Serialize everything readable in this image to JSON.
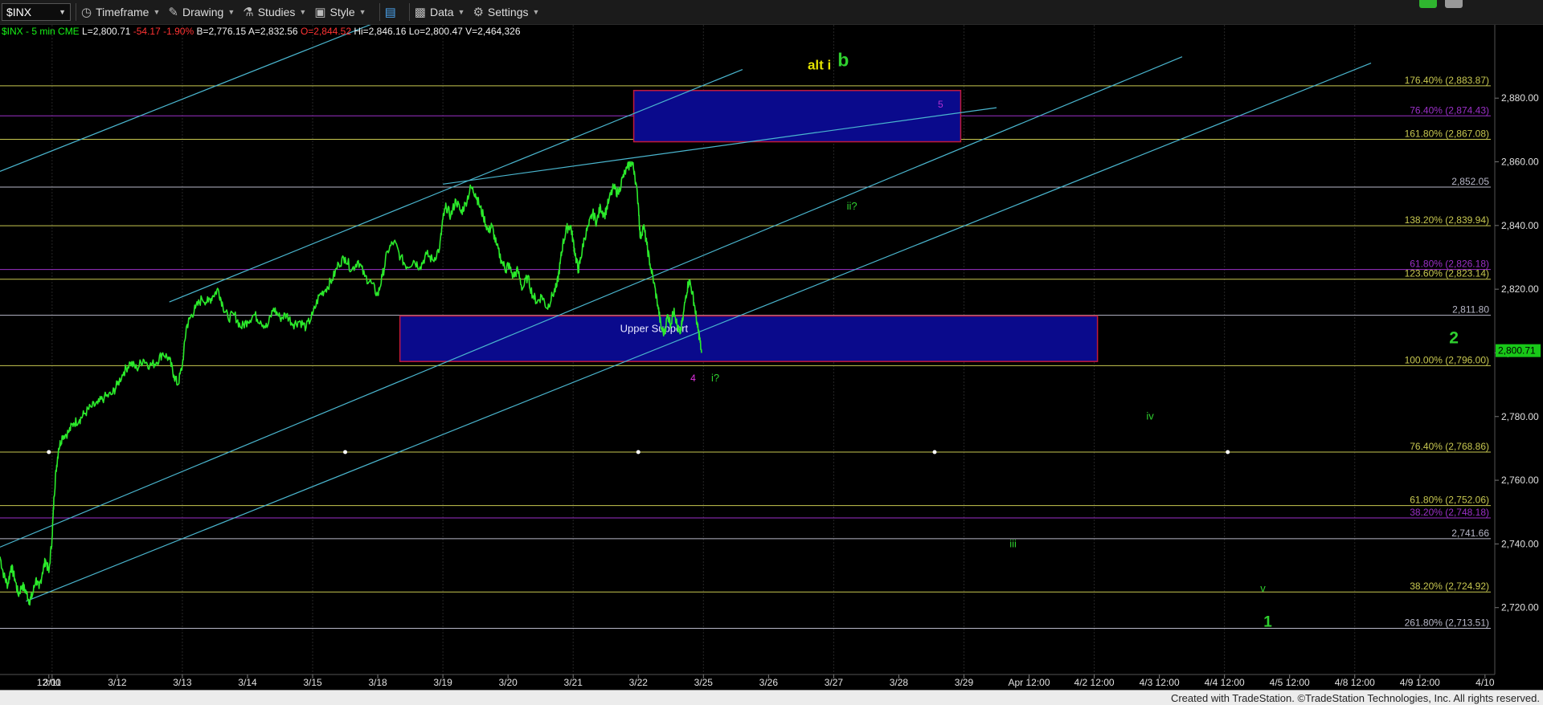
{
  "toolbar": {
    "symbol": "$INX",
    "timeframe": "Timeframe",
    "drawing": "Drawing",
    "studies": "Studies",
    "style": "Style",
    "data": "Data",
    "settings": "Settings"
  },
  "footer": "Created with TradeStation. ©TradeStation Technologies, Inc. All rights reserved.",
  "chart_data": {
    "type": "line",
    "info": [
      {
        "text": "$INX - 5 min",
        "color": "#17f317"
      },
      {
        "text": "CME",
        "color": "#17f317"
      },
      {
        "text": "L=2,800.71",
        "color": "#f0f0f0"
      },
      {
        "text": "-54.17",
        "color": "#ff3333"
      },
      {
        "text": "-1.90%",
        "color": "#ff3333"
      },
      {
        "text": "B=2,776.15",
        "color": "#f0f0f0"
      },
      {
        "text": "A=2,832.56",
        "color": "#f0f0f0"
      },
      {
        "text": "O=2,844.52",
        "color": "#ff3333"
      },
      {
        "text": "Hi=2,846.16",
        "color": "#f0f0f0"
      },
      {
        "text": "Lo=2,800.47",
        "color": "#f0f0f0"
      },
      {
        "text": "V=2,464,326",
        "color": "#f0f0f0"
      }
    ],
    "ylim": [
      2699,
      2903
    ],
    "y_ticks": [
      "2,880.00",
      "2,860.00",
      "2,840.00",
      "2,820.00",
      "2,800.00",
      "2,780.00",
      "2,760.00",
      "2,740.00",
      "2,720.00"
    ],
    "y_tick_values": [
      2880,
      2860,
      2840,
      2820,
      2800,
      2780,
      2760,
      2740,
      2720
    ],
    "x_domain": [
      -0.8,
      22.15
    ],
    "x_ticks": [
      {
        "t": -0.05,
        "label": "12:00"
      },
      {
        "t": 0,
        "label": "3/11"
      },
      {
        "t": 1,
        "label": "3/12"
      },
      {
        "t": 2,
        "label": "3/13"
      },
      {
        "t": 3,
        "label": "3/14"
      },
      {
        "t": 4,
        "label": "3/15"
      },
      {
        "t": 5,
        "label": "3/18"
      },
      {
        "t": 6,
        "label": "3/19"
      },
      {
        "t": 7,
        "label": "3/20"
      },
      {
        "t": 8,
        "label": "3/21"
      },
      {
        "t": 9,
        "label": "3/22"
      },
      {
        "t": 10,
        "label": "3/25"
      },
      {
        "t": 11,
        "label": "3/26"
      },
      {
        "t": 12,
        "label": "3/27"
      },
      {
        "t": 13,
        "label": "3/28"
      },
      {
        "t": 14,
        "label": "3/29"
      },
      {
        "t": 15,
        "label": "Apr 12:00"
      },
      {
        "t": 16,
        "label": "4/2 12:00"
      },
      {
        "t": 17,
        "label": "4/3 12:00"
      },
      {
        "t": 18,
        "label": "4/4 12:00"
      },
      {
        "t": 19,
        "label": "4/5 12:00"
      },
      {
        "t": 20,
        "label": "4/8 12:00"
      },
      {
        "t": 21,
        "label": "4/9 12:00"
      },
      {
        "t": 22,
        "label": "4/10"
      }
    ],
    "fib_levels": [
      {
        "value": 2883.87,
        "label": "176.40% (2,883.87)",
        "color": "#c8c850"
      },
      {
        "value": 2874.43,
        "label": "76.40% (2,874.43)",
        "color": "#9b30c8"
      },
      {
        "value": 2867.08,
        "label": "161.80% (2,867.08)",
        "color": "#c8c850"
      },
      {
        "value": 2852.05,
        "label": "2,852.05",
        "color": "#b8b8c8"
      },
      {
        "value": 2839.94,
        "label": "138.20% (2,839.94)",
        "color": "#c8c850"
      },
      {
        "value": 2826.18,
        "label": "61.80% (2,826.18)",
        "color": "#9b30c8"
      },
      {
        "value": 2823.14,
        "label": "123.60% (2,823.14)",
        "color": "#c8c850"
      },
      {
        "value": 2811.8,
        "label": "2,811.80",
        "color": "#b8b8c8"
      },
      {
        "value": 2796.0,
        "label": "100.00% (2,796.00)",
        "color": "#c8c850"
      },
      {
        "value": 2768.86,
        "label": "76.40% (2,768.86)",
        "color": "#c8c850"
      },
      {
        "value": 2752.06,
        "label": "61.80% (2,752.06)",
        "color": "#c8c850"
      },
      {
        "value": 2748.18,
        "label": "38.20% (2,748.18)",
        "color": "#9b30c8"
      },
      {
        "value": 2741.66,
        "label": "2,741.66",
        "color": "#b8b8c8"
      },
      {
        "value": 2724.92,
        "label": "38.20% (2,724.92)",
        "color": "#c8c850"
      },
      {
        "value": 2713.51,
        "label": "261.80% (2,713.51)",
        "color": "#b8b8c8"
      }
    ],
    "last_price": {
      "value": 2800.71,
      "label": "2,800.71"
    },
    "boxes": [
      {
        "t1": 8.93,
        "t2": 13.95,
        "y1": 2866.3,
        "y2": 2882.4,
        "label": ""
      },
      {
        "t1": 5.34,
        "t2": 16.05,
        "y1": 2797.3,
        "y2": 2811.6,
        "label": "Upper Support"
      }
    ],
    "trendlines": [
      {
        "t1": -0.8,
        "y1": 2857,
        "t2": 5.0,
        "y2": 2904
      },
      {
        "t1": 1.8,
        "y1": 2816,
        "t2": 10.6,
        "y2": 2889
      },
      {
        "t1": 6.0,
        "y1": 2853,
        "t2": 14.5,
        "y2": 2877
      },
      {
        "t1": -0.8,
        "y1": 2739,
        "t2": 17.35,
        "y2": 2893
      },
      {
        "t1": -0.4,
        "y1": 2722,
        "t2": 20.25,
        "y2": 2891
      }
    ],
    "vlines": [
      0,
      2,
      4,
      6,
      8,
      10,
      12,
      14,
      16,
      18,
      20
    ],
    "dots": [
      {
        "t": -0.05,
        "y": 2768.86
      },
      {
        "t": 4.5,
        "y": 2768.86
      },
      {
        "t": 9.0,
        "y": 2768.86
      },
      {
        "t": 13.55,
        "y": 2768.86
      },
      {
        "t": 18.05,
        "y": 2768.86
      }
    ],
    "price_path": [
      [
        -0.8,
        2736
      ],
      [
        -0.74,
        2730
      ],
      [
        -0.68,
        2727
      ],
      [
        -0.63,
        2733
      ],
      [
        -0.57,
        2729
      ],
      [
        -0.52,
        2724
      ],
      [
        -0.46,
        2727
      ],
      [
        -0.4,
        2725
      ],
      [
        -0.35,
        2722
      ],
      [
        -0.3,
        2724
      ],
      [
        -0.25,
        2729
      ],
      [
        -0.2,
        2726
      ],
      [
        -0.15,
        2731
      ],
      [
        -0.1,
        2735
      ],
      [
        -0.05,
        2731
      ],
      [
        0.0,
        2742
      ],
      [
        0.03,
        2755
      ],
      [
        0.06,
        2763
      ],
      [
        0.1,
        2770
      ],
      [
        0.16,
        2774
      ],
      [
        0.25,
        2775
      ],
      [
        0.33,
        2778
      ],
      [
        0.42,
        2779
      ],
      [
        0.5,
        2781
      ],
      [
        0.6,
        2783
      ],
      [
        0.7,
        2784
      ],
      [
        0.8,
        2786
      ],
      [
        0.92,
        2787
      ],
      [
        1.0,
        2790
      ],
      [
        1.1,
        2794
      ],
      [
        1.2,
        2797
      ],
      [
        1.3,
        2795
      ],
      [
        1.4,
        2798
      ],
      [
        1.5,
        2796
      ],
      [
        1.6,
        2797
      ],
      [
        1.7,
        2800
      ],
      [
        1.8,
        2798
      ],
      [
        1.87,
        2793
      ],
      [
        1.93,
        2790
      ],
      [
        2.0,
        2796
      ],
      [
        2.06,
        2808
      ],
      [
        2.12,
        2811
      ],
      [
        2.2,
        2814
      ],
      [
        2.3,
        2817
      ],
      [
        2.4,
        2816
      ],
      [
        2.47,
        2818
      ],
      [
        2.55,
        2820
      ],
      [
        2.62,
        2815
      ],
      [
        2.7,
        2811
      ],
      [
        2.8,
        2812
      ],
      [
        2.9,
        2808
      ],
      [
        3.0,
        2810
      ],
      [
        3.1,
        2812
      ],
      [
        3.2,
        2810
      ],
      [
        3.3,
        2808
      ],
      [
        3.4,
        2814
      ],
      [
        3.5,
        2811
      ],
      [
        3.6,
        2812
      ],
      [
        3.7,
        2809
      ],
      [
        3.8,
        2810
      ],
      [
        3.9,
        2808
      ],
      [
        4.0,
        2812
      ],
      [
        4.1,
        2818
      ],
      [
        4.2,
        2820
      ],
      [
        4.3,
        2823
      ],
      [
        4.4,
        2828
      ],
      [
        4.5,
        2830
      ],
      [
        4.6,
        2826
      ],
      [
        4.7,
        2829
      ],
      [
        4.8,
        2824
      ],
      [
        4.9,
        2822
      ],
      [
        5.0,
        2818
      ],
      [
        5.07,
        2824
      ],
      [
        5.15,
        2832
      ],
      [
        5.25,
        2835
      ],
      [
        5.35,
        2830
      ],
      [
        5.45,
        2827
      ],
      [
        5.55,
        2829
      ],
      [
        5.65,
        2827
      ],
      [
        5.75,
        2831
      ],
      [
        5.85,
        2829
      ],
      [
        5.95,
        2833
      ],
      [
        6.0,
        2842
      ],
      [
        6.05,
        2846
      ],
      [
        6.12,
        2843
      ],
      [
        6.2,
        2848
      ],
      [
        6.28,
        2844
      ],
      [
        6.35,
        2847
      ],
      [
        6.43,
        2852
      ],
      [
        6.5,
        2850
      ],
      [
        6.55,
        2847
      ],
      [
        6.62,
        2843
      ],
      [
        6.7,
        2838
      ],
      [
        6.75,
        2840
      ],
      [
        6.82,
        2834
      ],
      [
        6.9,
        2829
      ],
      [
        6.97,
        2826
      ],
      [
        7.0,
        2828
      ],
      [
        7.08,
        2824
      ],
      [
        7.15,
        2826
      ],
      [
        7.22,
        2820
      ],
      [
        7.3,
        2824
      ],
      [
        7.38,
        2818
      ],
      [
        7.45,
        2816
      ],
      [
        7.52,
        2818
      ],
      [
        7.6,
        2814
      ],
      [
        7.68,
        2818
      ],
      [
        7.75,
        2821
      ],
      [
        7.8,
        2828
      ],
      [
        7.84,
        2834
      ],
      [
        7.9,
        2839
      ],
      [
        7.96,
        2840
      ],
      [
        8.0,
        2835
      ],
      [
        8.04,
        2830
      ],
      [
        8.08,
        2826
      ],
      [
        8.12,
        2830
      ],
      [
        8.17,
        2836
      ],
      [
        8.24,
        2840
      ],
      [
        8.3,
        2844
      ],
      [
        8.36,
        2841
      ],
      [
        8.42,
        2846
      ],
      [
        8.48,
        2843
      ],
      [
        8.55,
        2848
      ],
      [
        8.62,
        2852
      ],
      [
        8.69,
        2850
      ],
      [
        8.76,
        2855
      ],
      [
        8.83,
        2858
      ],
      [
        8.9,
        2860
      ],
      [
        8.94,
        2857
      ],
      [
        9.0,
        2847
      ],
      [
        9.03,
        2836
      ],
      [
        9.08,
        2840
      ],
      [
        9.13,
        2834
      ],
      [
        9.18,
        2828
      ],
      [
        9.24,
        2822
      ],
      [
        9.3,
        2815
      ],
      [
        9.35,
        2808
      ],
      [
        9.4,
        2806
      ],
      [
        9.45,
        2812
      ],
      [
        9.5,
        2809
      ],
      [
        9.55,
        2814
      ],
      [
        9.6,
        2808
      ],
      [
        9.64,
        2806
      ],
      [
        9.68,
        2810
      ],
      [
        9.73,
        2818
      ],
      [
        9.78,
        2823
      ],
      [
        9.83,
        2819
      ],
      [
        9.87,
        2814
      ],
      [
        9.91,
        2808
      ],
      [
        9.94,
        2805
      ],
      [
        9.97,
        2800
      ]
    ],
    "annotations": [
      {
        "text": "alt i",
        "t": 11.6,
        "y": 2889,
        "color": "#e3e300",
        "size": 17,
        "bold": true
      },
      {
        "text": "b",
        "t": 12.06,
        "y": 2890,
        "color": "#2fd02f",
        "size": 23,
        "bold": true
      },
      {
        "text": "5",
        "t": 13.6,
        "y": 2877,
        "color": "#b030d0",
        "size": 12,
        "bold": false
      },
      {
        "text": "ii?",
        "t": 12.2,
        "y": 2845,
        "color": "#2fd02f",
        "size": 13,
        "bold": false
      },
      {
        "text": "4",
        "t": 9.8,
        "y": 2791,
        "color": "#e030e0",
        "size": 12,
        "bold": false
      },
      {
        "text": "i?",
        "t": 10.12,
        "y": 2791,
        "color": "#2fd02f",
        "size": 13,
        "bold": false
      },
      {
        "text": "iv",
        "t": 16.8,
        "y": 2779,
        "color": "#2fd02f",
        "size": 13,
        "bold": false
      },
      {
        "text": "iii",
        "t": 14.7,
        "y": 2739,
        "color": "#2fd02f",
        "size": 13,
        "bold": false
      },
      {
        "text": "v",
        "t": 18.55,
        "y": 2725,
        "color": "#2fd02f",
        "size": 13,
        "bold": false
      },
      {
        "text": "1",
        "t": 18.6,
        "y": 2714,
        "color": "#2fd02f",
        "size": 19,
        "bold": true
      },
      {
        "text": "2",
        "t": 21.45,
        "y": 2803,
        "color": "#2fd02f",
        "size": 21,
        "bold": true
      }
    ]
  }
}
